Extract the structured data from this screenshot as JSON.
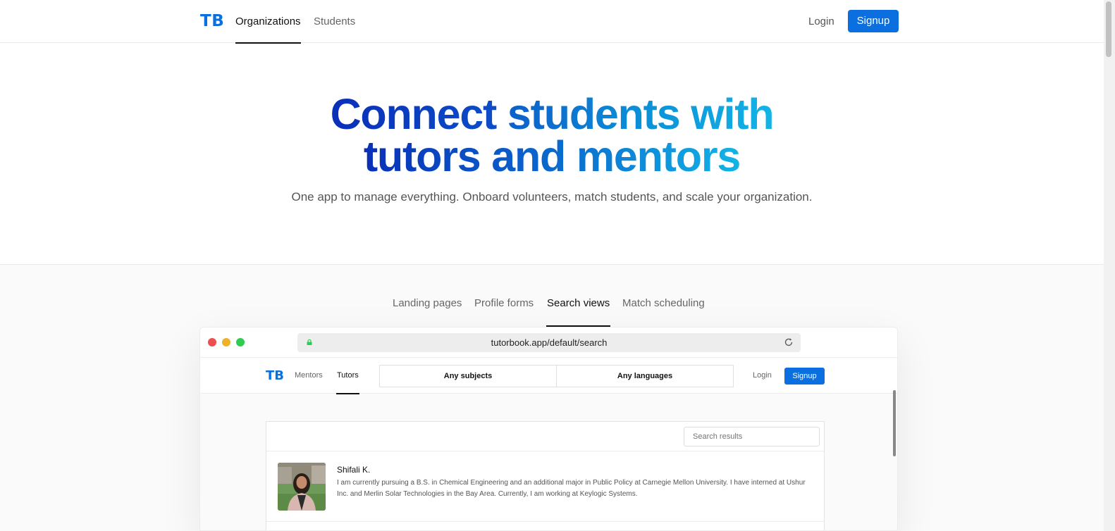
{
  "header": {
    "logo": "TB",
    "tabs": [
      {
        "label": "Organizations",
        "active": true
      },
      {
        "label": "Students",
        "active": false
      }
    ],
    "login_label": "Login",
    "signup_label": "Signup"
  },
  "hero": {
    "title_line1_a": "Connect ",
    "title_line1_b": "students with",
    "title_line2": "tutors and mentors",
    "subtitle": "One app to manage everything. Onboard volunteers, match students, and scale your organization."
  },
  "demo": {
    "tabs": [
      {
        "label": "Landing pages",
        "active": false
      },
      {
        "label": "Profile forms",
        "active": false
      },
      {
        "label": "Search views",
        "active": true
      },
      {
        "label": "Match scheduling",
        "active": false
      }
    ],
    "browser": {
      "url": "tutorbook.app/default/search",
      "window_dots": [
        "#ed4f4f",
        "#f0b12a",
        "#2ecc52"
      ]
    },
    "app": {
      "logo": "TB",
      "tabs": [
        {
          "label": "Mentors",
          "active": false
        },
        {
          "label": "Tutors",
          "active": true
        }
      ],
      "filters": [
        "Any subjects",
        "Any languages"
      ],
      "login_label": "Login",
      "signup_label": "Signup",
      "search_placeholder": "Search results",
      "results": [
        {
          "name": "Shifali K.",
          "bio": "I am currently pursuing a B.S. in Chemical Engineering and an additional major in Public Policy at Carnegie Mellon University. I have interned at Ushur Inc. and Merlin Solar Technologies in the Bay Area. Currently, I am working at Keylogic Systems."
        }
      ]
    }
  },
  "colors": {
    "brand": "#0b6fdf",
    "gradient_start": "#0a2fb8",
    "gradient_end": "#13b4e6"
  }
}
